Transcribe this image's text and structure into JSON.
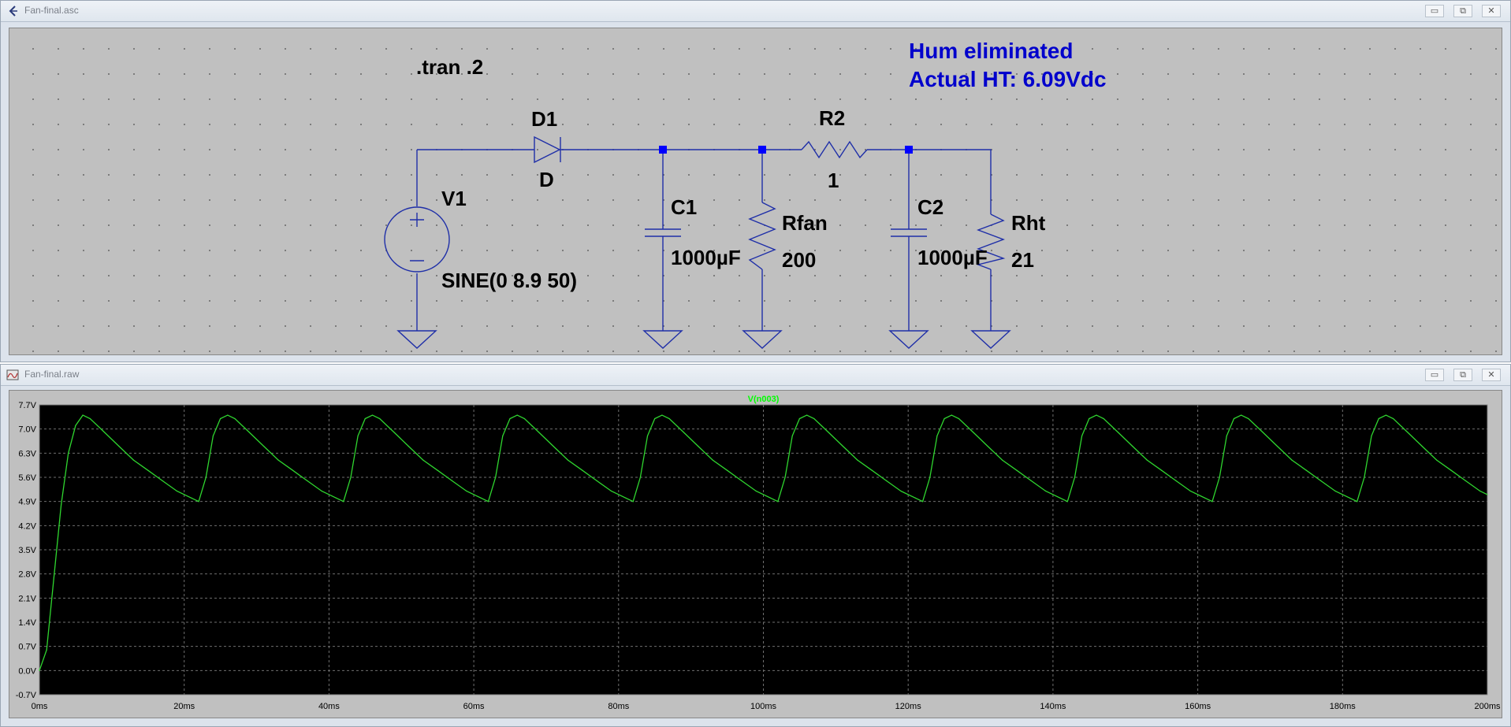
{
  "schematic_window": {
    "title": "Fan-final.asc"
  },
  "plot_window": {
    "title": "Fan-final.raw"
  },
  "window_buttons": {
    "minimize": "▭",
    "restore": "⧉",
    "close": "✕"
  },
  "schematic": {
    "directive": ".tran .2",
    "note_line1": "Hum eliminated",
    "note_line2": "Actual HT: 6.09Vdc",
    "components": {
      "V1": {
        "name": "V1",
        "value": "SINE(0 8.9 50)"
      },
      "D1": {
        "name": "D1",
        "value": "D"
      },
      "C1": {
        "name": "C1",
        "value": "1000µF"
      },
      "Rfan": {
        "name": "Rfan",
        "value": "200"
      },
      "R2": {
        "name": "R2",
        "value": "1"
      },
      "C2": {
        "name": "C2",
        "value": "1000µF"
      },
      "Rht": {
        "name": "Rht",
        "value": "21"
      }
    },
    "colors": {
      "wire": "#1f2fa8",
      "node": "#0000ff",
      "text": "#000000",
      "note": "#0000cc",
      "background": "#c0c0c0"
    }
  },
  "chart_data": {
    "type": "line",
    "trace_label": "V(n003)",
    "x_ticks": [
      "0ms",
      "20ms",
      "40ms",
      "60ms",
      "80ms",
      "100ms",
      "120ms",
      "140ms",
      "160ms",
      "180ms",
      "200ms"
    ],
    "y_ticks": [
      "7.7V",
      "7.0V",
      "6.3V",
      "5.6V",
      "4.9V",
      "4.2V",
      "3.5V",
      "2.8V",
      "2.1V",
      "1.4V",
      "0.7V",
      "0.0V",
      "-0.7V"
    ],
    "xlim": [
      0,
      200
    ],
    "ylim": [
      -0.7,
      7.7
    ],
    "x_unit": "ms",
    "y_unit": "V",
    "grid": true,
    "colors": {
      "trace": "#2fd62f",
      "background": "#000000",
      "grid": "#6f6f6f",
      "label": "#00ff00"
    },
    "series": [
      {
        "x": [
          0,
          1,
          2,
          3,
          4,
          5,
          6,
          7,
          9,
          11,
          13,
          15,
          17,
          19,
          21,
          22,
          23,
          24,
          25,
          26,
          27,
          29,
          31,
          33,
          35,
          37,
          39,
          41,
          42,
          43,
          44,
          45,
          46,
          47,
          49,
          51,
          53,
          55,
          57,
          59,
          61,
          62,
          63,
          64,
          65,
          66,
          67,
          69,
          71,
          73,
          75,
          77,
          79,
          81,
          82,
          83,
          84,
          85,
          86,
          87,
          89,
          91,
          93,
          95,
          97,
          99,
          101,
          102,
          103,
          104,
          105,
          106,
          107,
          109,
          111,
          113,
          115,
          117,
          119,
          121,
          122,
          123,
          124,
          125,
          126,
          127,
          129,
          131,
          133,
          135,
          137,
          139,
          141,
          142,
          143,
          144,
          145,
          146,
          147,
          149,
          151,
          153,
          155,
          157,
          159,
          161,
          162,
          163,
          164,
          165,
          166,
          167,
          169,
          171,
          173,
          175,
          177,
          179,
          181,
          182,
          183,
          184,
          185,
          186,
          187,
          189,
          191,
          193,
          195,
          197,
          199,
          200
        ],
        "y": [
          0.0,
          0.6,
          2.7,
          4.8,
          6.3,
          7.1,
          7.4,
          7.3,
          6.9,
          6.5,
          6.1,
          5.8,
          5.5,
          5.2,
          5.0,
          4.9,
          5.6,
          6.8,
          7.3,
          7.4,
          7.3,
          6.9,
          6.5,
          6.1,
          5.8,
          5.5,
          5.2,
          5.0,
          4.9,
          5.6,
          6.8,
          7.3,
          7.4,
          7.3,
          6.9,
          6.5,
          6.1,
          5.8,
          5.5,
          5.2,
          5.0,
          4.9,
          5.6,
          6.8,
          7.3,
          7.4,
          7.3,
          6.9,
          6.5,
          6.1,
          5.8,
          5.5,
          5.2,
          5.0,
          4.9,
          5.6,
          6.8,
          7.3,
          7.4,
          7.3,
          6.9,
          6.5,
          6.1,
          5.8,
          5.5,
          5.2,
          5.0,
          4.9,
          5.6,
          6.8,
          7.3,
          7.4,
          7.3,
          6.9,
          6.5,
          6.1,
          5.8,
          5.5,
          5.2,
          5.0,
          4.9,
          5.6,
          6.8,
          7.3,
          7.4,
          7.3,
          6.9,
          6.5,
          6.1,
          5.8,
          5.5,
          5.2,
          5.0,
          4.9,
          5.6,
          6.8,
          7.3,
          7.4,
          7.3,
          6.9,
          6.5,
          6.1,
          5.8,
          5.5,
          5.2,
          5.0,
          4.9,
          5.6,
          6.8,
          7.3,
          7.4,
          7.3,
          6.9,
          6.5,
          6.1,
          5.8,
          5.5,
          5.2,
          5.0,
          4.9,
          5.6,
          6.8,
          7.3,
          7.4,
          7.3,
          6.9,
          6.5,
          6.1,
          5.8,
          5.5,
          5.2,
          5.1
        ]
      }
    ]
  }
}
